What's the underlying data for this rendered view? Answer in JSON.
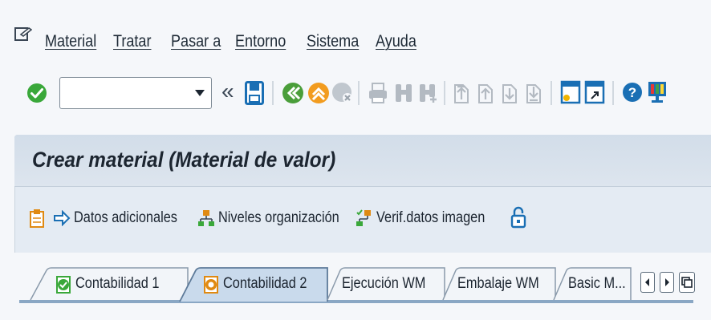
{
  "menubar": {
    "items": [
      {
        "label": "Material"
      },
      {
        "label": "Tratar"
      },
      {
        "label": "Pasar a"
      },
      {
        "label": "Entorno"
      },
      {
        "label": "Sistema"
      },
      {
        "label": "Ayuda"
      }
    ]
  },
  "toolbar": {
    "command_field_value": "",
    "back_glyph": "«"
  },
  "page": {
    "title": "Crear material (Material de valor)"
  },
  "app_toolbar": {
    "datos_adicionales": "Datos adicionales",
    "niveles_organizacion": "Niveles organización",
    "verif_datos_imagen": "Verif.datos imagen"
  },
  "tabs": [
    {
      "label": "Contabilidad 1",
      "state": "done"
    },
    {
      "label": "Contabilidad 2",
      "state": "active"
    },
    {
      "label": "Ejecución WM"
    },
    {
      "label": "Embalaje WM"
    },
    {
      "label": "Basic M..."
    }
  ],
  "colors": {
    "accent_blue": "#1a6fb4",
    "title_band": "#d2dde9",
    "tab_active": "#c9daec",
    "ok_green": "#3aa83a"
  }
}
